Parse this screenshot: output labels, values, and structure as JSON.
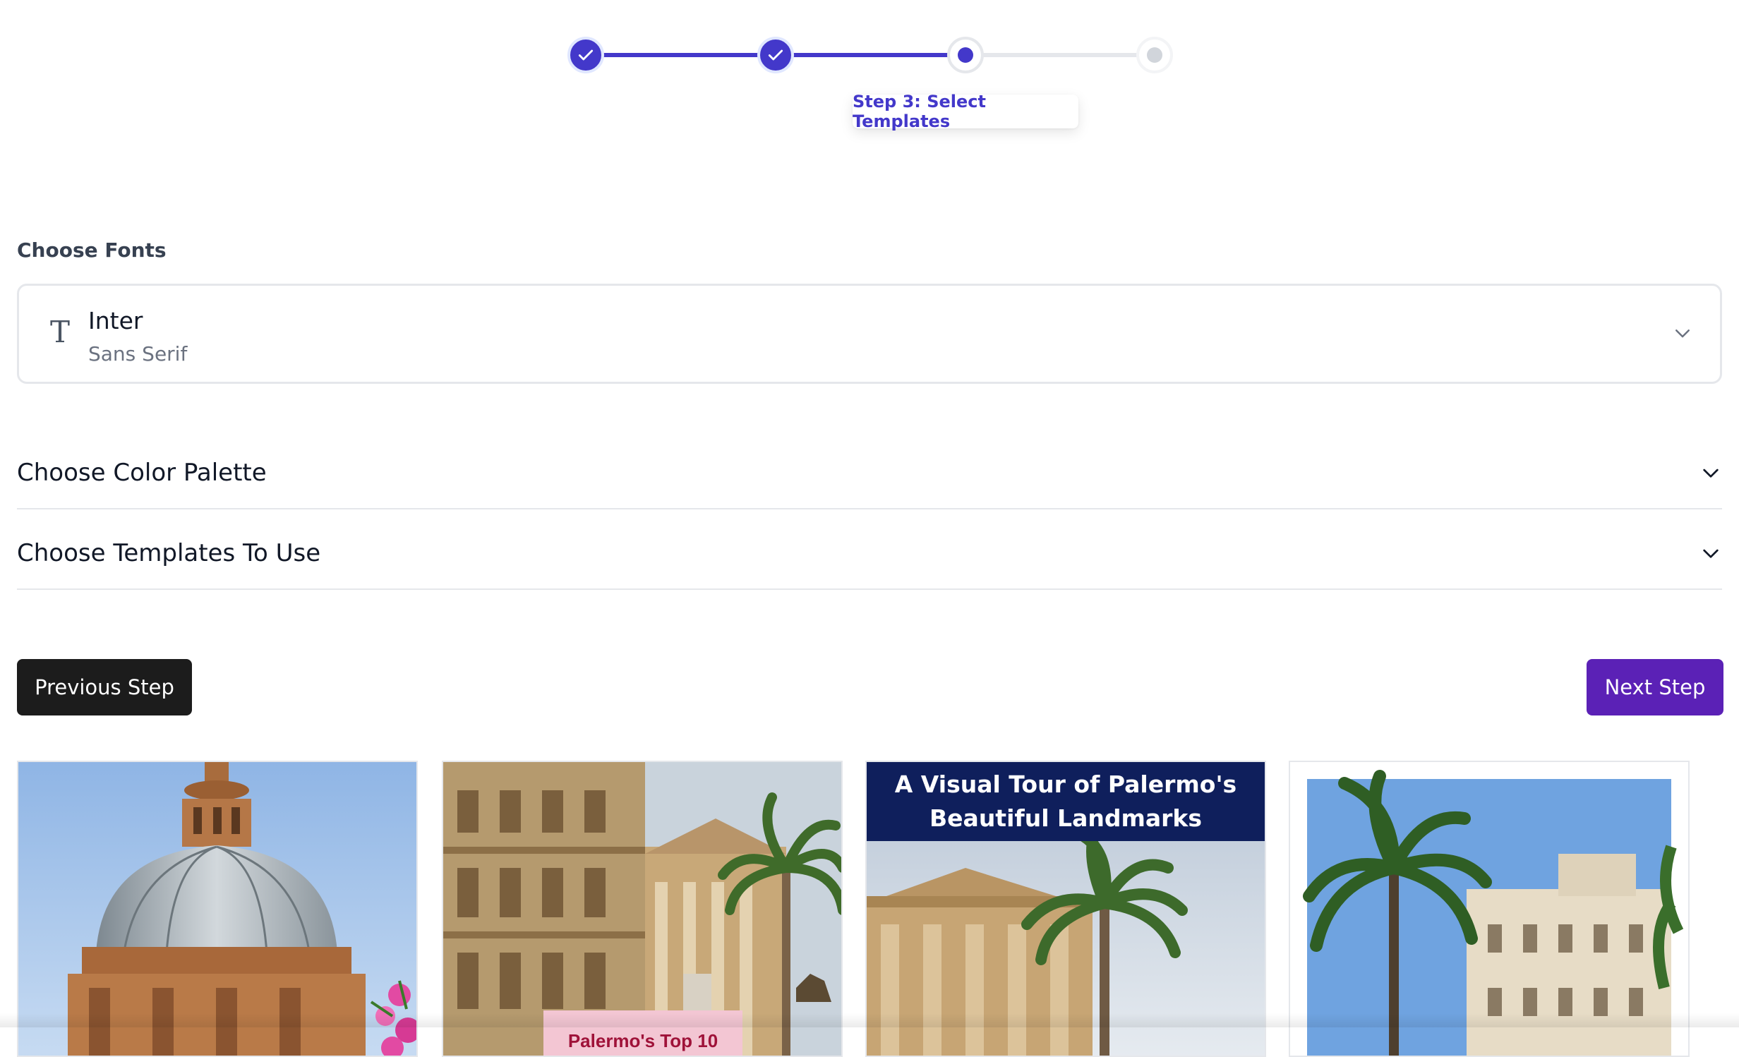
{
  "stepper": {
    "current_label": "Step 3: Select Templates",
    "steps": [
      {
        "state": "done"
      },
      {
        "state": "done"
      },
      {
        "state": "current"
      },
      {
        "state": "todo"
      }
    ],
    "accent": "#4338ca"
  },
  "fonts": {
    "section_title": "Choose Fonts",
    "selected_name": "Inter",
    "selected_category": "Sans Serif",
    "icon": "type-icon"
  },
  "accordions": [
    {
      "label": "Choose Color Palette"
    },
    {
      "label": "Choose Templates To Use"
    }
  ],
  "buttons": {
    "previous": "Previous Step",
    "next": "Next Step"
  },
  "templates": [
    {
      "kind": "cathedral-dome-photo"
    },
    {
      "kind": "collage-photo",
      "tag": "Palermo's Top 10"
    },
    {
      "kind": "banner-photo",
      "banner_line1": "A Visual Tour of Palermo's",
      "banner_line2": "Beautiful Landmarks"
    },
    {
      "kind": "framed-palm-photo"
    }
  ],
  "colors": {
    "primary_button": "#5b21b6",
    "dark_button": "#1c1c1c",
    "banner": "#0f1f5c"
  }
}
